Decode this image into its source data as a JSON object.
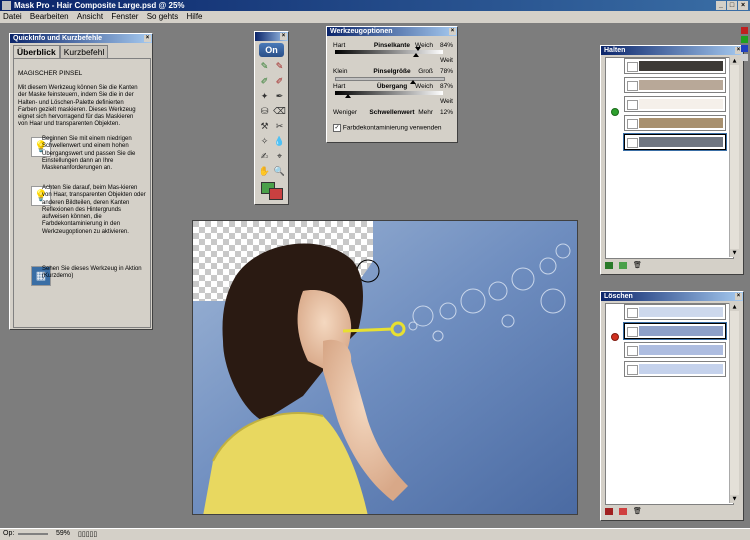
{
  "window": {
    "title": "Mask Pro - Hair Composite Large.psd @ 25%"
  },
  "menu": [
    "Datei",
    "Bearbeiten",
    "Ansicht",
    "Fenster",
    "So gehts",
    "Hilfe"
  ],
  "quickinfo": {
    "title": "QuickInfo und Kurzbefehle",
    "tabs": [
      "Überblick",
      "Kurzbefehl"
    ],
    "heading": "MAGISCHER PINSEL",
    "intro": "Mit diesem Werkzeug können Sie die Kanten der Maske feinsteuern, indem Sie die in der Halten- und Löschen-Palette definierten Farben gezielt maskieren. Dieses Werkzeug eignet sich hervorragend für das Maskieren von Haar und transparenten Objekten.",
    "tip1": "Beginnen Sie mit einem niedrigen Schwellenwert und einem hohen Übergangswert und passen Sie die Einstellungen dann an Ihre Maskenanforderungen an.",
    "tip2": "Achten Sie darauf, beim Mas-kieren von Haar, transparenten Objekten oder anderen Bildteilen, deren Kanten Reflexionen des Hintergrunds aufweisen können, die Farbdekontaminierung in den Werkzeugoptionen zu aktivieren.",
    "tip3": "Sehen Sie dieses Werkzeug in Aktion (Kurzdemo)"
  },
  "toolbox": {
    "logo": "On"
  },
  "options": {
    "title": "Werkzeugoptionen",
    "row1": {
      "left": "Hart",
      "center": "Pinselkante",
      "right": "Weich",
      "value": "84%"
    },
    "row1b": {
      "right": "Weit"
    },
    "row2": {
      "left": "Klein",
      "center": "Pinselgröße",
      "right": "Groß",
      "value": "78%"
    },
    "row3": {
      "left": "Hart",
      "center": "Übergang",
      "right": "Weich",
      "value": "87%"
    },
    "row3b": {
      "right": "Weit"
    },
    "row4": {
      "left": "Weniger",
      "center": "Schwellenwert",
      "right": "Mehr",
      "value": "12%"
    },
    "checkbox": "Farbdekontaminierung verwenden"
  },
  "halten": {
    "title": "Halten",
    "swatches": [
      "#3d3a36",
      "#b8a898",
      "#f5f0ea",
      "#a8906e",
      "#6f7682"
    ]
  },
  "loschen": {
    "title": "Löschen",
    "swatches": [
      "#cdd8ec",
      "#8ea0c8",
      "#aebde0",
      "#c5d2ec"
    ]
  },
  "status": {
    "label": "Op:",
    "zoom": "59%"
  },
  "colors": {
    "titlebar": "#0a246a",
    "face": "#d4d0c8",
    "workspace": "#7d7d7d"
  }
}
